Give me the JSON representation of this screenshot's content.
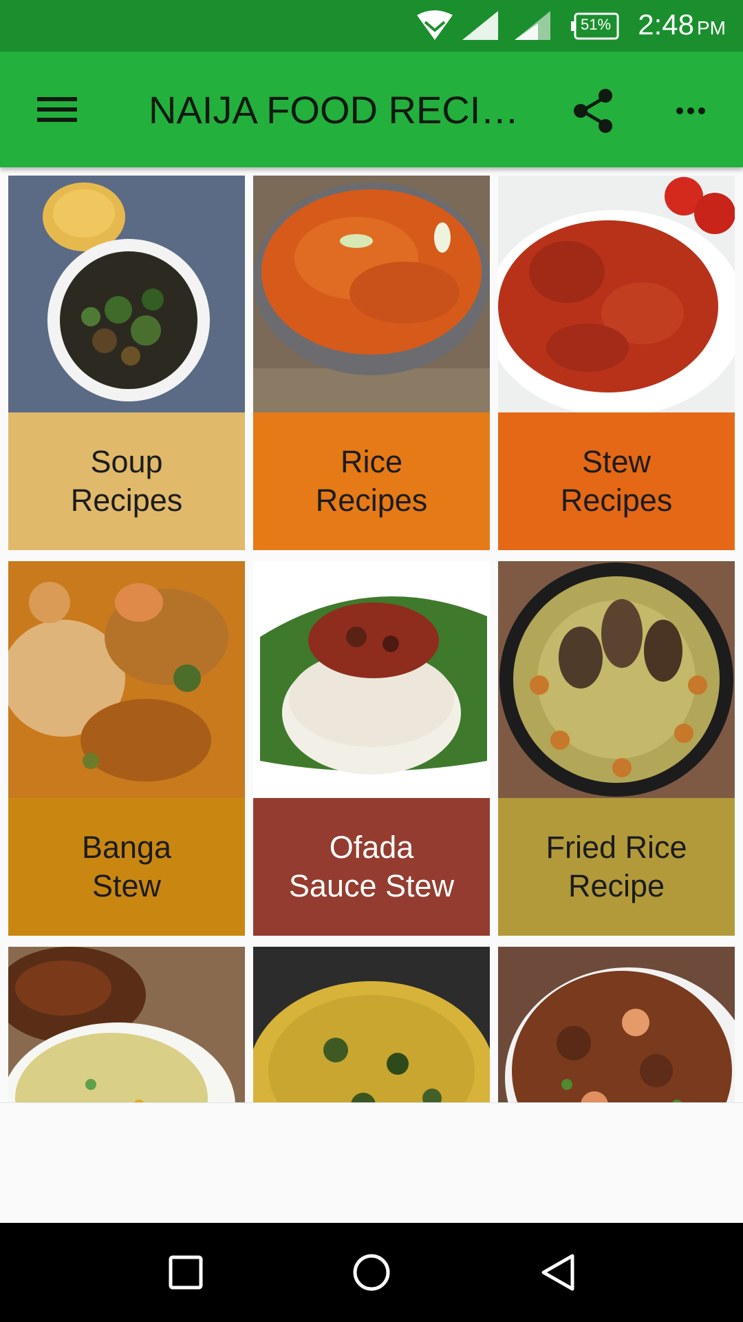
{
  "status_bar": {
    "battery": "51%",
    "time": "2:48",
    "ampm": "PM"
  },
  "app_bar": {
    "title": "NAIJA FOOD RECI…"
  },
  "tiles": [
    {
      "label": "Soup\nRecipes",
      "label_color": "#e0b96a",
      "image": "egusi-soup-with-eba"
    },
    {
      "label": "Rice\nRecipes",
      "label_color": "#e57a16",
      "image": "jollof-rice-bowl"
    },
    {
      "label": "Stew\nRecipes",
      "label_color": "#e56816",
      "image": "tomato-chicken-stew"
    },
    {
      "label": "Banga\nStew",
      "label_color": "#c98712",
      "image": "banga-stew-fish"
    },
    {
      "label": "Ofada\nSauce Stew",
      "label_color": "#943c30",
      "image": "ofada-rice-on-leaf"
    },
    {
      "label": "Fried Rice\nRecipe",
      "label_color": "#b29a3a",
      "image": "fried-rice-with-chicken"
    },
    {
      "label": "",
      "label_color": "",
      "image": "fried-rice-and-chicken"
    },
    {
      "label": "",
      "label_color": "",
      "image": "vegetable-rice"
    },
    {
      "label": "",
      "label_color": "",
      "image": "seafood-stew"
    }
  ],
  "colors": {
    "status_bar": "#1b8f2e",
    "app_bar": "#23b03d"
  }
}
